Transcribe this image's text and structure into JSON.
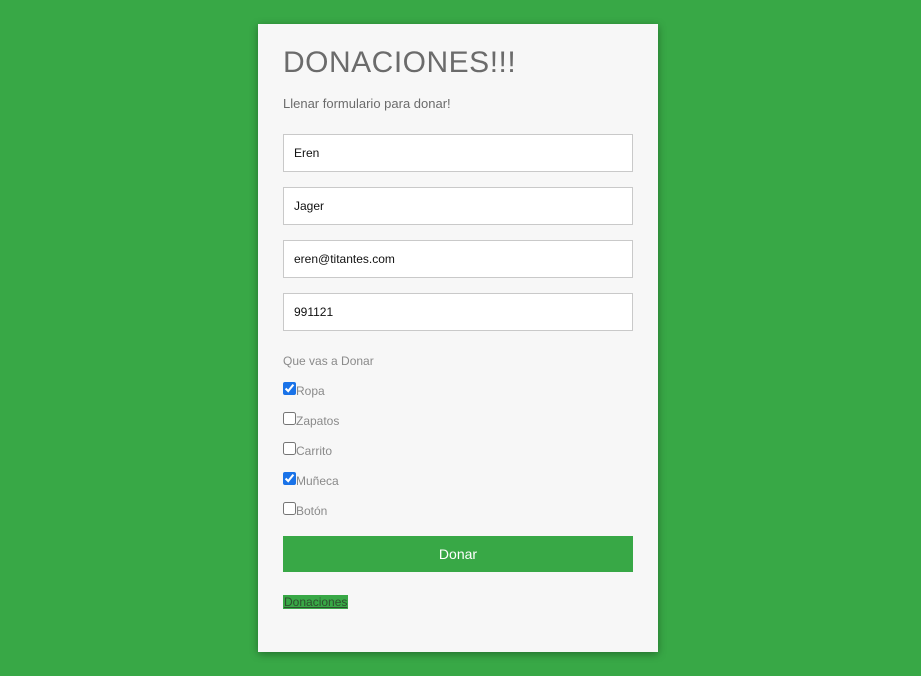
{
  "form": {
    "title": "DONACIONES!!!",
    "subtitle": "Llenar formulario para donar!",
    "fields": {
      "first_name": "Eren",
      "last_name": "Jager",
      "email": "eren@titantes.com",
      "phone": "991121"
    },
    "group_label": "Que vas a Donar",
    "options": [
      {
        "label": "Ropa",
        "checked": true
      },
      {
        "label": "Zapatos",
        "checked": false
      },
      {
        "label": "Carrito",
        "checked": false
      },
      {
        "label": "Muñeca",
        "checked": true
      },
      {
        "label": "Botón",
        "checked": false
      }
    ],
    "submit_label": "Donar",
    "link_label": "Donaciones"
  },
  "colors": {
    "background": "#38a846",
    "card": "#f7f7f7",
    "button": "#38a846",
    "checkbox_accent": "#1a73e8"
  }
}
